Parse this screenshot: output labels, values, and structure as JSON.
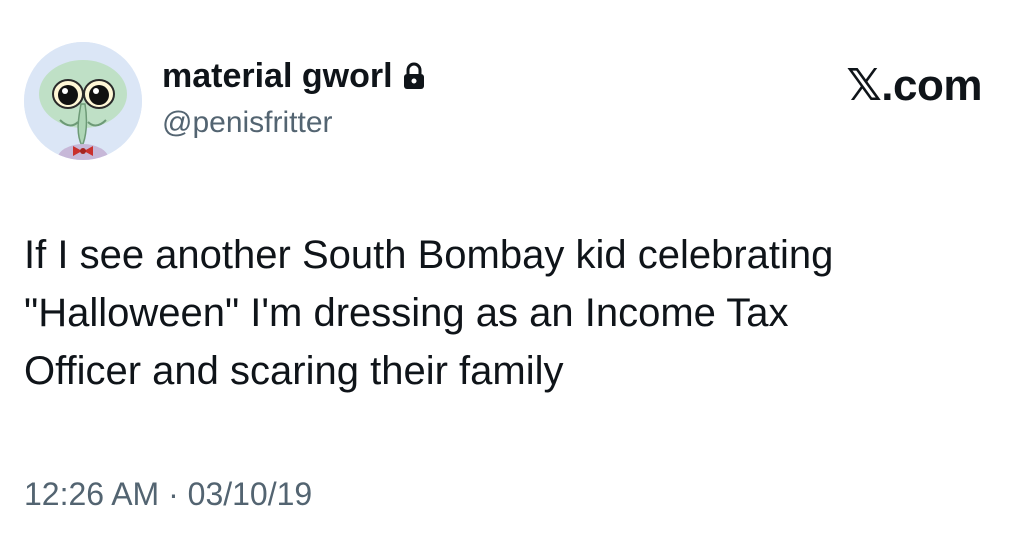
{
  "author": {
    "display_name": "material gworl",
    "handle": "@penisfritter",
    "avatar_icon": "squidward-avatar",
    "lock_icon": "lock-icon"
  },
  "brand": {
    "label": "𝕏.com"
  },
  "tweet": {
    "lines": [
      "If I see another South Bombay kid celebrating",
      "\"Halloween\" I'm dressing as an Income Tax",
      "Officer and scaring their family"
    ]
  },
  "meta": {
    "time": "12:26 AM",
    "separator": "·",
    "date": "03/10/19"
  },
  "colors": {
    "text": "#0f1419",
    "secondary": "#536471"
  }
}
